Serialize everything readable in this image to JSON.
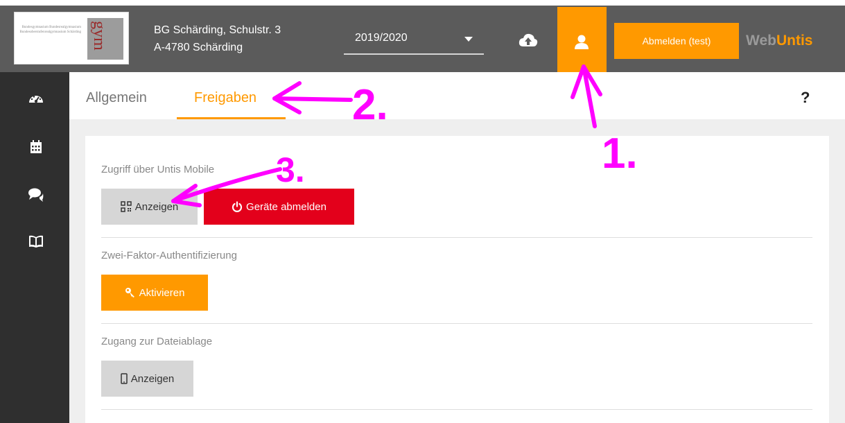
{
  "header": {
    "school_line1": "BG Schärding, Schulstr. 3",
    "school_line2": "A-4780 Schärding",
    "logo_word": "gym",
    "logo_text": "Bundesgymnasium Bundesrealgymnasium Bundesoberstufenrealgymnasium Schärding",
    "school_year": "2019/2020",
    "logout_label": "Abmelden (test)",
    "brand_web": "Web",
    "brand_untis": "Untis",
    "accent": "#ff9900"
  },
  "sidebar": {
    "items": [
      {
        "icon": "dashboard-icon"
      },
      {
        "icon": "calendar-icon"
      },
      {
        "icon": "messages-icon"
      },
      {
        "icon": "book-icon"
      }
    ]
  },
  "tabs": [
    {
      "label": "Allgemein",
      "active": false
    },
    {
      "label": "Freigaben",
      "active": true
    }
  ],
  "help_label": "?",
  "sections": {
    "mobile": {
      "label": "Zugriff über Untis Mobile",
      "show_label": "Anzeigen",
      "logout_devices_label": "Geräte abmelden"
    },
    "twofactor": {
      "label": "Zwei-Faktor-Authentifizierung",
      "activate_label": "Aktivieren"
    },
    "files": {
      "label": "Zugang zur Dateiablage",
      "show_label": "Anzeigen"
    }
  },
  "annotations": {
    "step1": "1.",
    "step2": "2.",
    "step3": "3.",
    "color": "#ff00ff"
  }
}
